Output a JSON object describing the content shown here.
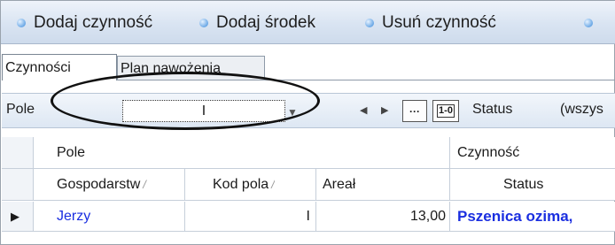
{
  "toolbar": {
    "add_activity": "Dodaj czynność",
    "add_product": "Dodaj środek",
    "delete_activity": "Usuń czynność"
  },
  "tabs": {
    "activities": "Czynności",
    "fertilization_plan": "Plan nawożenia"
  },
  "filter": {
    "field_label": "Pole",
    "field_value": "I",
    "status_label": "Status",
    "status_value": "(wszys",
    "dots": "···",
    "reset": "1-0"
  },
  "grid": {
    "group_header": {
      "field": "Pole",
      "activity": "Czynność"
    },
    "columns": {
      "farm": "Gospodarstw",
      "field_code": "Kod pola",
      "area": "Areał",
      "status": "Status"
    },
    "rows": [
      {
        "farm": "Jerzy",
        "field_code": "I",
        "area": "13,00",
        "activity": "Pszenica ozima,"
      }
    ]
  },
  "colors": {
    "link_blue": "#1a2ee0",
    "toolbar_bullet": "#6aa8e6"
  }
}
